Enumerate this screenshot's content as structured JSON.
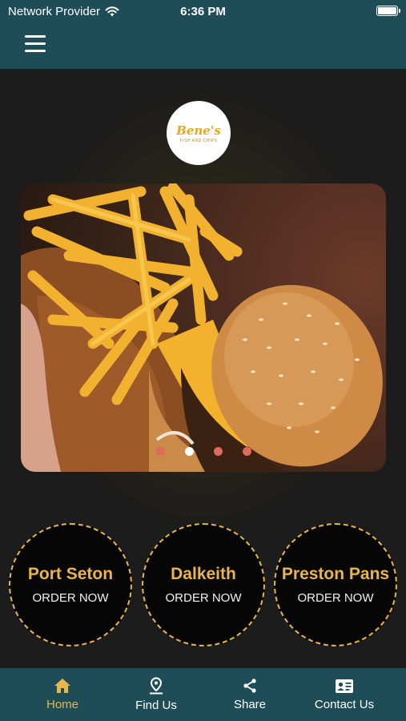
{
  "status_bar": {
    "carrier": "Network Provider",
    "time": "6:36 PM",
    "icons": [
      "wifi-icon",
      "battery-icon"
    ]
  },
  "app_bar": {
    "menu_icon": "hamburger-menu-icon"
  },
  "logo": {
    "script_text": "Bene's",
    "tagline": "FISH AND CHIPS"
  },
  "carousel": {
    "dot_count": 4,
    "active_index": 1,
    "image_subject": "burger and fries"
  },
  "locations": [
    {
      "name": "Port Seton",
      "action": "ORDER NOW"
    },
    {
      "name": "Dalkeith",
      "action": "ORDER NOW"
    },
    {
      "name": "Preston Pans",
      "action": "ORDER NOW"
    }
  ],
  "bottom_nav": [
    {
      "label": "Home",
      "icon": "home-icon",
      "active": true
    },
    {
      "label": "Find Us",
      "icon": "location-pin-icon",
      "active": false
    },
    {
      "label": "Share",
      "icon": "share-icon",
      "active": false
    },
    {
      "label": "Contact Us",
      "icon": "contact-card-icon",
      "active": false
    }
  ],
  "colors": {
    "bar_teal": "#1f4d57",
    "accent_gold": "#e8b64c",
    "background": "#1c1c1c",
    "dot_inactive": "#e26a5a"
  }
}
